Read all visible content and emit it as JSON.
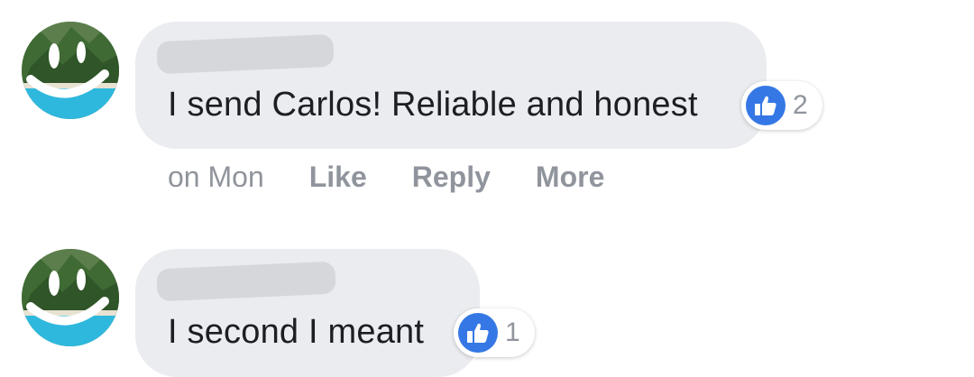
{
  "comments": [
    {
      "author_avatar": "smiley-avatar",
      "text": "I send Carlos! Reliable and honest",
      "reactions": {
        "icon": "like-icon",
        "count": "2"
      },
      "timestamp": "on Mon",
      "actions": {
        "like": "Like",
        "reply": "Reply",
        "more": "More"
      }
    },
    {
      "author_avatar": "smiley-avatar",
      "text": "I second I meant",
      "reactions": {
        "icon": "like-icon",
        "count": "1"
      }
    }
  ],
  "colors": {
    "bubble": "#ebecf0",
    "text": "#1c1e21",
    "muted": "#90949c",
    "like_blue": "#3578e5",
    "redaction": "#d6d7da"
  }
}
